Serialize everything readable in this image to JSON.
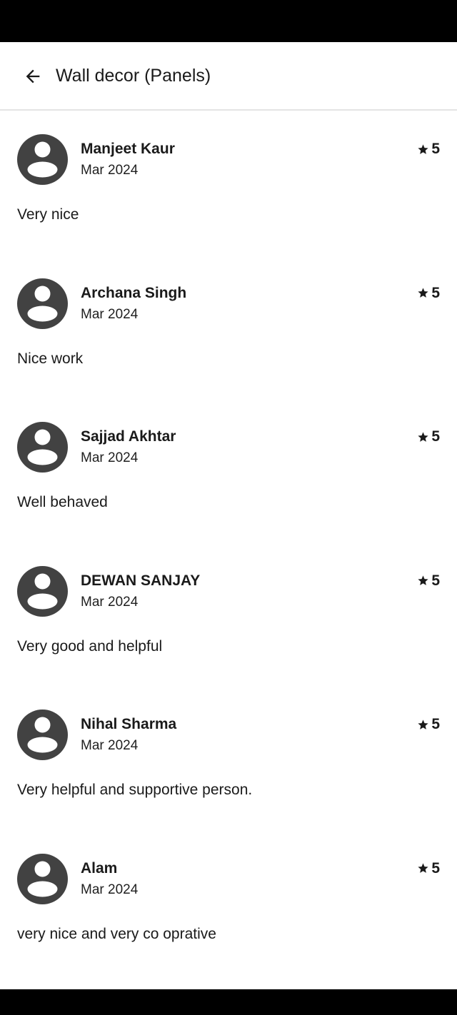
{
  "header": {
    "title": "Wall decor (Panels)",
    "back_icon": "arrow-left-icon"
  },
  "colors": {
    "avatar": "#424242",
    "text": "#1a1a1a",
    "system_bars": "#000000"
  },
  "reviews": [
    {
      "name": "Manjeet Kaur",
      "date": "Mar 2024",
      "rating": "5",
      "text": "Very nice"
    },
    {
      "name": "Archana Singh",
      "date": "Mar 2024",
      "rating": "5",
      "text": "Nice work"
    },
    {
      "name": "Sajjad Akhtar",
      "date": "Mar 2024",
      "rating": "5",
      "text": "Well behaved"
    },
    {
      "name": "DEWAN SANJAY",
      "date": "Mar 2024",
      "rating": "5",
      "text": "Very good and helpful"
    },
    {
      "name": "Nihal Sharma",
      "date": "Mar 2024",
      "rating": "5",
      "text": "Very helpful and supportive person."
    },
    {
      "name": "Alam",
      "date": "Mar 2024",
      "rating": "5",
      "text": "very nice and very co oprative"
    }
  ]
}
